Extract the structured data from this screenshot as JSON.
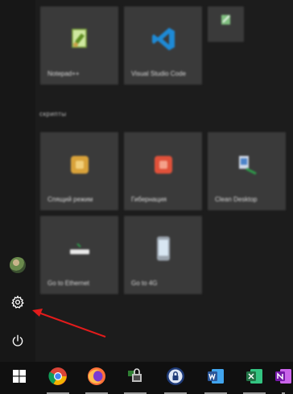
{
  "start_menu": {
    "group_label": "Скрипты",
    "tiles": {
      "notepad": "Notepad++",
      "vscode": "Visual Studio Code",
      "small_app": "",
      "sleep": "Спящий режим",
      "hibernate": "Гибернация",
      "clean_desktop": "Clean Desktop",
      "ethernet": "Go to Ethernet",
      "four_g": "Go to 4G"
    }
  },
  "rail": {
    "items": [
      "user-avatar",
      "settings",
      "power"
    ]
  },
  "taskbar": {
    "items": [
      "start",
      "chrome",
      "firefox",
      "vpn-lock",
      "lock-app",
      "word",
      "excel",
      "onenote"
    ]
  },
  "colors": {
    "annotation_arrow": "#e31b1b",
    "tile_bg": "#3a3a3a",
    "word": "#2b579a",
    "excel": "#217346",
    "onenote": "#7719aa"
  }
}
